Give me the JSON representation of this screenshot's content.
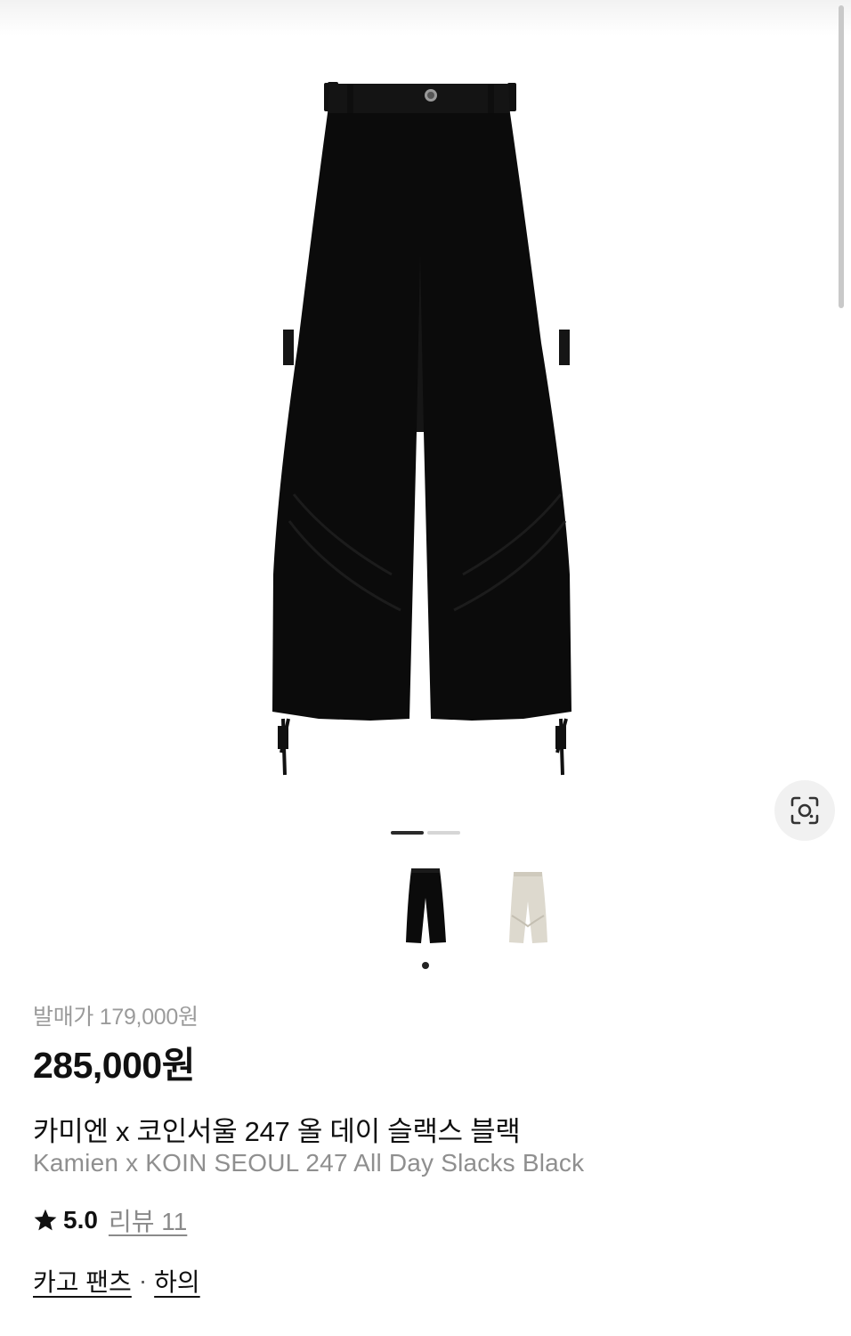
{
  "gallery": {
    "images": [
      "black",
      "ivory"
    ],
    "active_index": 0
  },
  "product": {
    "release_price": "발매가 179,000원",
    "price": "285,000원",
    "name_ko": "카미엔 x 코인서울 247 올 데이 슬랙스 블랙",
    "name_en": "Kamien x KOIN SEOUL 247 All Day Slacks Black"
  },
  "rating": {
    "score": "5.0",
    "review_label": "리뷰 11",
    "icon": "star-icon"
  },
  "categories": {
    "primary": "카고 팬츠",
    "separator": "·",
    "secondary": "하의"
  },
  "colors": {
    "price": "#111111",
    "muted": "#9b9b9b",
    "pager_active": "#2a2a2a",
    "pager_inactive": "#d6d6d6"
  }
}
